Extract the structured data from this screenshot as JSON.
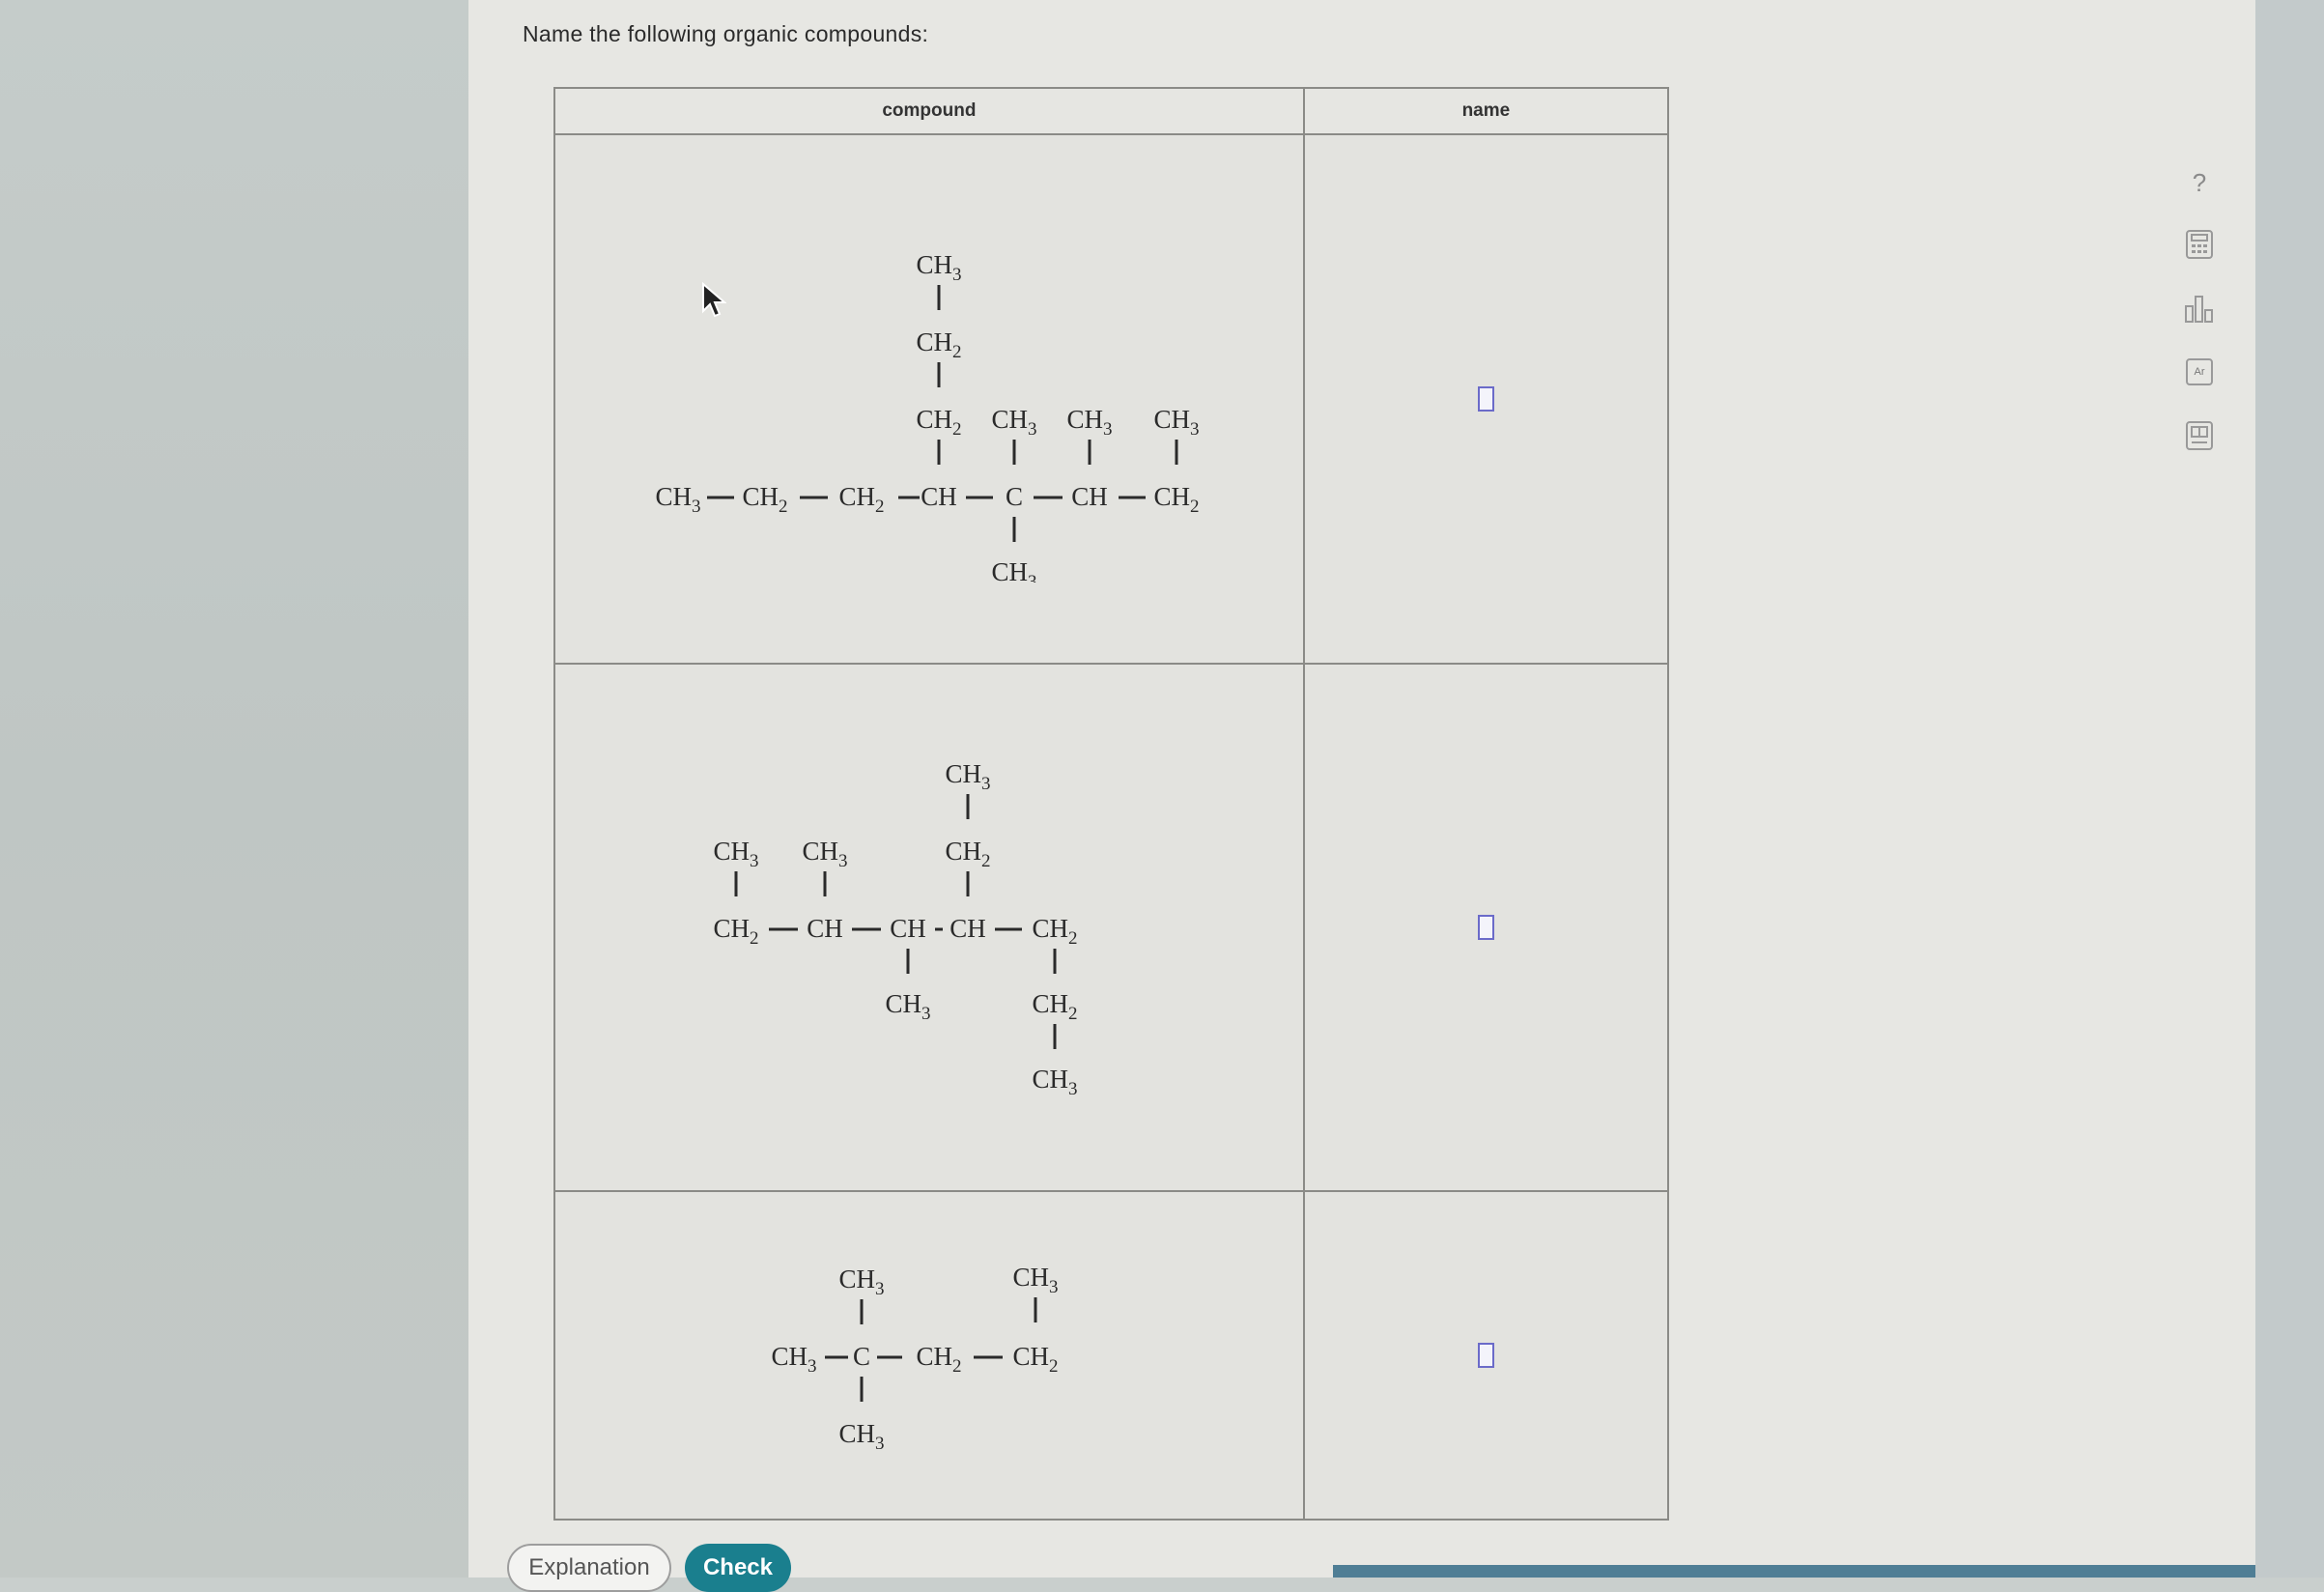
{
  "prompt": "Name the following organic compounds:",
  "table": {
    "col_compound": "compound",
    "col_name": "name"
  },
  "buttons": {
    "explanation": "Explanation",
    "check": "Check"
  },
  "toolbar": {
    "help": "?",
    "periodic_label": "Ar"
  },
  "molecules": {
    "m1": {
      "top_ch3": "CH3",
      "top_ch2a": "CH2",
      "top_ch2b": "CH2",
      "sub_ch3_a": "CH3",
      "sub_ch3_b": "CH3",
      "sub_ch3_c": "CH3",
      "chain": [
        "CH3",
        "CH2",
        "CH2",
        "CH",
        "C",
        "CH",
        "CH2"
      ],
      "bottom_ch3": "CH3"
    },
    "m2": {
      "top_ch3": "CH3",
      "top_ch2": "CH2",
      "left_ch3_a": "CH3",
      "left_ch3_b": "CH3",
      "chain": [
        "CH2",
        "CH",
        "CH",
        "CH",
        "CH2"
      ],
      "under_ch3": "CH3",
      "right_ch2": "CH2",
      "right_ch3": "CH3"
    },
    "m3": {
      "top_ch3_a": "CH3",
      "top_ch3_b": "CH3",
      "chain": [
        "CH3",
        "C",
        "CH2",
        "CH2"
      ],
      "bottom_ch3": "CH3"
    }
  }
}
